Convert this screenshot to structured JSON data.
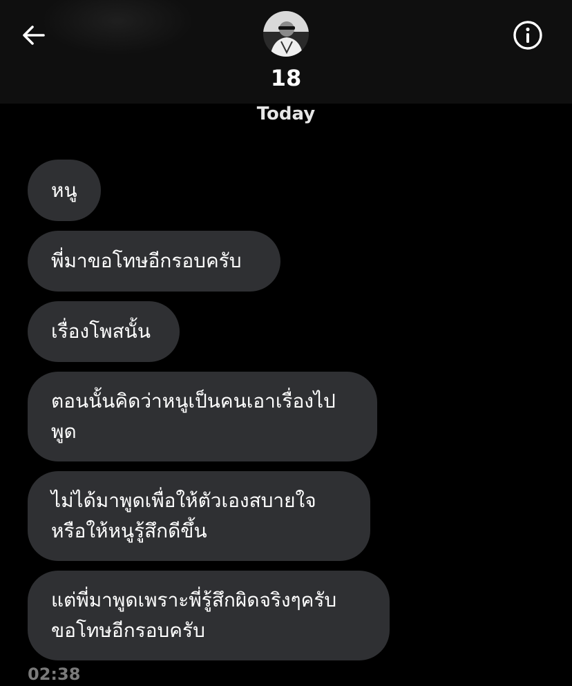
{
  "header": {
    "back_icon": "arrow-left-icon",
    "info_icon": "info-circle-icon",
    "contact_name": "18",
    "avatar": "contact-avatar"
  },
  "chat": {
    "date_separator": "Today",
    "messages": [
      {
        "text": "หนู"
      },
      {
        "text": "พี่มาขอโทษอีกรอบครับ"
      },
      {
        "text": "เรื่องโพสนั้น"
      },
      {
        "text": "ตอนนั้นคิดว่าหนูเป็นคนเอาเรื่องไป\nพูด"
      },
      {
        "text": "ไม่ได้มาพูดเพื่อให้ตัวเองสบายใจ\nหรือให้หนูรู้สึกดีขึ้น"
      },
      {
        "text": "แต่พี่มาพูดเพราะพี่รู้สึกผิดจริงๆครับ\nขอโทษอีกรอบครับ"
      }
    ],
    "last_timestamp": "02:38"
  },
  "colors": {
    "background": "#000000",
    "header_bg": "#0f0f0f",
    "bubble_bg": "#2f3033",
    "timestamp": "#7a7a7a"
  }
}
